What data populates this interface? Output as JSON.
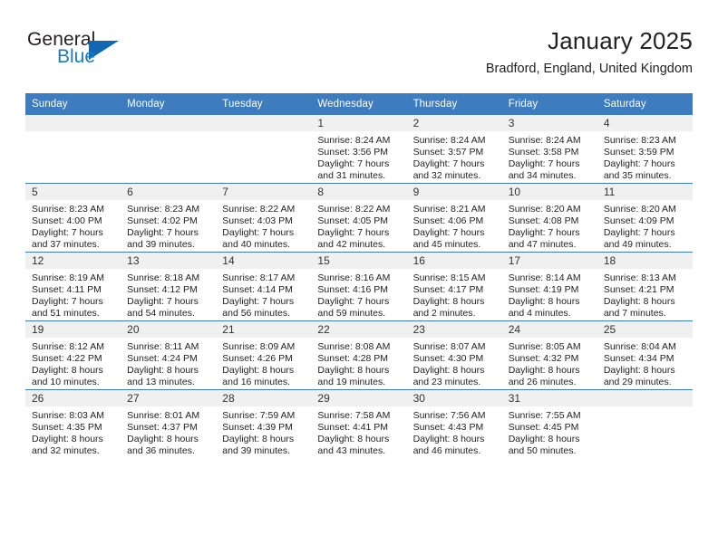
{
  "brand": {
    "name_top": "General",
    "name_bottom": "Blue",
    "triangle_color": "#1167b1",
    "blue_text_color": "#1a7ac4"
  },
  "header": {
    "title": "January 2025",
    "subtitle": "Bradford, England, United Kingdom"
  },
  "theme": {
    "header_row_bg": "#3d7cbf",
    "date_strip_bg": "#f0f0f0",
    "row_divider": "#3d7cbf"
  },
  "calendar": {
    "weekday_headers": [
      "Sunday",
      "Monday",
      "Tuesday",
      "Wednesday",
      "Thursday",
      "Friday",
      "Saturday"
    ],
    "weeks": [
      [
        {
          "empty": true
        },
        {
          "empty": true
        },
        {
          "empty": true
        },
        {
          "date": "1",
          "sunrise": "Sunrise: 8:24 AM",
          "sunset": "Sunset: 3:56 PM",
          "daylight_line1": "Daylight: 7 hours",
          "daylight_line2": "and 31 minutes."
        },
        {
          "date": "2",
          "sunrise": "Sunrise: 8:24 AM",
          "sunset": "Sunset: 3:57 PM",
          "daylight_line1": "Daylight: 7 hours",
          "daylight_line2": "and 32 minutes."
        },
        {
          "date": "3",
          "sunrise": "Sunrise: 8:24 AM",
          "sunset": "Sunset: 3:58 PM",
          "daylight_line1": "Daylight: 7 hours",
          "daylight_line2": "and 34 minutes."
        },
        {
          "date": "4",
          "sunrise": "Sunrise: 8:23 AM",
          "sunset": "Sunset: 3:59 PM",
          "daylight_line1": "Daylight: 7 hours",
          "daylight_line2": "and 35 minutes."
        }
      ],
      [
        {
          "date": "5",
          "sunrise": "Sunrise: 8:23 AM",
          "sunset": "Sunset: 4:00 PM",
          "daylight_line1": "Daylight: 7 hours",
          "daylight_line2": "and 37 minutes."
        },
        {
          "date": "6",
          "sunrise": "Sunrise: 8:23 AM",
          "sunset": "Sunset: 4:02 PM",
          "daylight_line1": "Daylight: 7 hours",
          "daylight_line2": "and 39 minutes."
        },
        {
          "date": "7",
          "sunrise": "Sunrise: 8:22 AM",
          "sunset": "Sunset: 4:03 PM",
          "daylight_line1": "Daylight: 7 hours",
          "daylight_line2": "and 40 minutes."
        },
        {
          "date": "8",
          "sunrise": "Sunrise: 8:22 AM",
          "sunset": "Sunset: 4:05 PM",
          "daylight_line1": "Daylight: 7 hours",
          "daylight_line2": "and 42 minutes."
        },
        {
          "date": "9",
          "sunrise": "Sunrise: 8:21 AM",
          "sunset": "Sunset: 4:06 PM",
          "daylight_line1": "Daylight: 7 hours",
          "daylight_line2": "and 45 minutes."
        },
        {
          "date": "10",
          "sunrise": "Sunrise: 8:20 AM",
          "sunset": "Sunset: 4:08 PM",
          "daylight_line1": "Daylight: 7 hours",
          "daylight_line2": "and 47 minutes."
        },
        {
          "date": "11",
          "sunrise": "Sunrise: 8:20 AM",
          "sunset": "Sunset: 4:09 PM",
          "daylight_line1": "Daylight: 7 hours",
          "daylight_line2": "and 49 minutes."
        }
      ],
      [
        {
          "date": "12",
          "sunrise": "Sunrise: 8:19 AM",
          "sunset": "Sunset: 4:11 PM",
          "daylight_line1": "Daylight: 7 hours",
          "daylight_line2": "and 51 minutes."
        },
        {
          "date": "13",
          "sunrise": "Sunrise: 8:18 AM",
          "sunset": "Sunset: 4:12 PM",
          "daylight_line1": "Daylight: 7 hours",
          "daylight_line2": "and 54 minutes."
        },
        {
          "date": "14",
          "sunrise": "Sunrise: 8:17 AM",
          "sunset": "Sunset: 4:14 PM",
          "daylight_line1": "Daylight: 7 hours",
          "daylight_line2": "and 56 minutes."
        },
        {
          "date": "15",
          "sunrise": "Sunrise: 8:16 AM",
          "sunset": "Sunset: 4:16 PM",
          "daylight_line1": "Daylight: 7 hours",
          "daylight_line2": "and 59 minutes."
        },
        {
          "date": "16",
          "sunrise": "Sunrise: 8:15 AM",
          "sunset": "Sunset: 4:17 PM",
          "daylight_line1": "Daylight: 8 hours",
          "daylight_line2": "and 2 minutes."
        },
        {
          "date": "17",
          "sunrise": "Sunrise: 8:14 AM",
          "sunset": "Sunset: 4:19 PM",
          "daylight_line1": "Daylight: 8 hours",
          "daylight_line2": "and 4 minutes."
        },
        {
          "date": "18",
          "sunrise": "Sunrise: 8:13 AM",
          "sunset": "Sunset: 4:21 PM",
          "daylight_line1": "Daylight: 8 hours",
          "daylight_line2": "and 7 minutes."
        }
      ],
      [
        {
          "date": "19",
          "sunrise": "Sunrise: 8:12 AM",
          "sunset": "Sunset: 4:22 PM",
          "daylight_line1": "Daylight: 8 hours",
          "daylight_line2": "and 10 minutes."
        },
        {
          "date": "20",
          "sunrise": "Sunrise: 8:11 AM",
          "sunset": "Sunset: 4:24 PM",
          "daylight_line1": "Daylight: 8 hours",
          "daylight_line2": "and 13 minutes."
        },
        {
          "date": "21",
          "sunrise": "Sunrise: 8:09 AM",
          "sunset": "Sunset: 4:26 PM",
          "daylight_line1": "Daylight: 8 hours",
          "daylight_line2": "and 16 minutes."
        },
        {
          "date": "22",
          "sunrise": "Sunrise: 8:08 AM",
          "sunset": "Sunset: 4:28 PM",
          "daylight_line1": "Daylight: 8 hours",
          "daylight_line2": "and 19 minutes."
        },
        {
          "date": "23",
          "sunrise": "Sunrise: 8:07 AM",
          "sunset": "Sunset: 4:30 PM",
          "daylight_line1": "Daylight: 8 hours",
          "daylight_line2": "and 23 minutes."
        },
        {
          "date": "24",
          "sunrise": "Sunrise: 8:05 AM",
          "sunset": "Sunset: 4:32 PM",
          "daylight_line1": "Daylight: 8 hours",
          "daylight_line2": "and 26 minutes."
        },
        {
          "date": "25",
          "sunrise": "Sunrise: 8:04 AM",
          "sunset": "Sunset: 4:34 PM",
          "daylight_line1": "Daylight: 8 hours",
          "daylight_line2": "and 29 minutes."
        }
      ],
      [
        {
          "date": "26",
          "sunrise": "Sunrise: 8:03 AM",
          "sunset": "Sunset: 4:35 PM",
          "daylight_line1": "Daylight: 8 hours",
          "daylight_line2": "and 32 minutes."
        },
        {
          "date": "27",
          "sunrise": "Sunrise: 8:01 AM",
          "sunset": "Sunset: 4:37 PM",
          "daylight_line1": "Daylight: 8 hours",
          "daylight_line2": "and 36 minutes."
        },
        {
          "date": "28",
          "sunrise": "Sunrise: 7:59 AM",
          "sunset": "Sunset: 4:39 PM",
          "daylight_line1": "Daylight: 8 hours",
          "daylight_line2": "and 39 minutes."
        },
        {
          "date": "29",
          "sunrise": "Sunrise: 7:58 AM",
          "sunset": "Sunset: 4:41 PM",
          "daylight_line1": "Daylight: 8 hours",
          "daylight_line2": "and 43 minutes."
        },
        {
          "date": "30",
          "sunrise": "Sunrise: 7:56 AM",
          "sunset": "Sunset: 4:43 PM",
          "daylight_line1": "Daylight: 8 hours",
          "daylight_line2": "and 46 minutes."
        },
        {
          "date": "31",
          "sunrise": "Sunrise: 7:55 AM",
          "sunset": "Sunset: 4:45 PM",
          "daylight_line1": "Daylight: 8 hours",
          "daylight_line2": "and 50 minutes."
        },
        {
          "empty": true
        }
      ]
    ]
  }
}
